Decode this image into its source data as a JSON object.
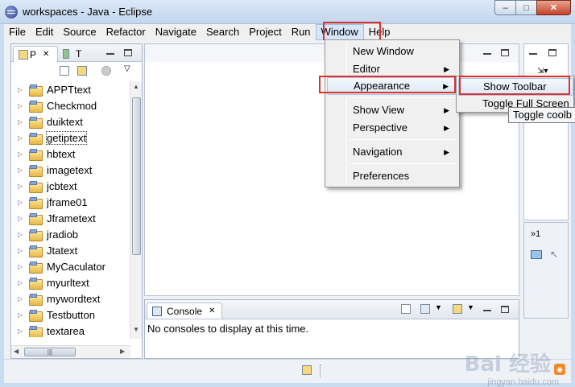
{
  "window": {
    "title": "workspaces - Java - Eclipse",
    "minimize": "–",
    "maximize": "□",
    "close": "✕"
  },
  "menubar": {
    "items": [
      "File",
      "Edit",
      "Source",
      "Refactor",
      "Navigate",
      "Search",
      "Project",
      "Run",
      "Window",
      "Help"
    ],
    "active": "Window"
  },
  "explorer": {
    "tabs": [
      {
        "label": "P",
        "close": "✕"
      },
      {
        "label": "T"
      }
    ],
    "projects": [
      "APPTtext",
      "Checkmod",
      "duiktext",
      "getiptext",
      "hbtext",
      "imagetext",
      "jcbtext",
      "jframe01",
      "Jframetext",
      "jradiob",
      "Jtatext",
      "MyCaculator",
      "myurltext",
      "mywordtext",
      "Testbutton",
      "textarea"
    ],
    "focused": "getiptext"
  },
  "window_menu": {
    "items": [
      {
        "label": "New Window",
        "submenu": false
      },
      {
        "label": "Editor",
        "submenu": true
      },
      {
        "label": "Appearance",
        "submenu": true,
        "highlighted": true
      },
      {
        "label": "Show View",
        "submenu": true
      },
      {
        "label": "Perspective",
        "submenu": true
      },
      {
        "label": "Navigation",
        "submenu": true
      },
      {
        "label": "Preferences",
        "submenu": false
      }
    ]
  },
  "appearance_submenu": {
    "items": [
      "Show Toolbar",
      "Toggle Full Screen"
    ]
  },
  "tooltip": "Toggle coolb",
  "console": {
    "tab_label": "Console",
    "message": "No consoles to display at this time."
  },
  "right_panel": {
    "label": "»1"
  },
  "watermark": {
    "text": "Bai 经验",
    "sub": "jingyan.baidu.com"
  },
  "colors": {
    "highlight_box": "#e0302a",
    "menu_hot": "#dbe8f8"
  }
}
